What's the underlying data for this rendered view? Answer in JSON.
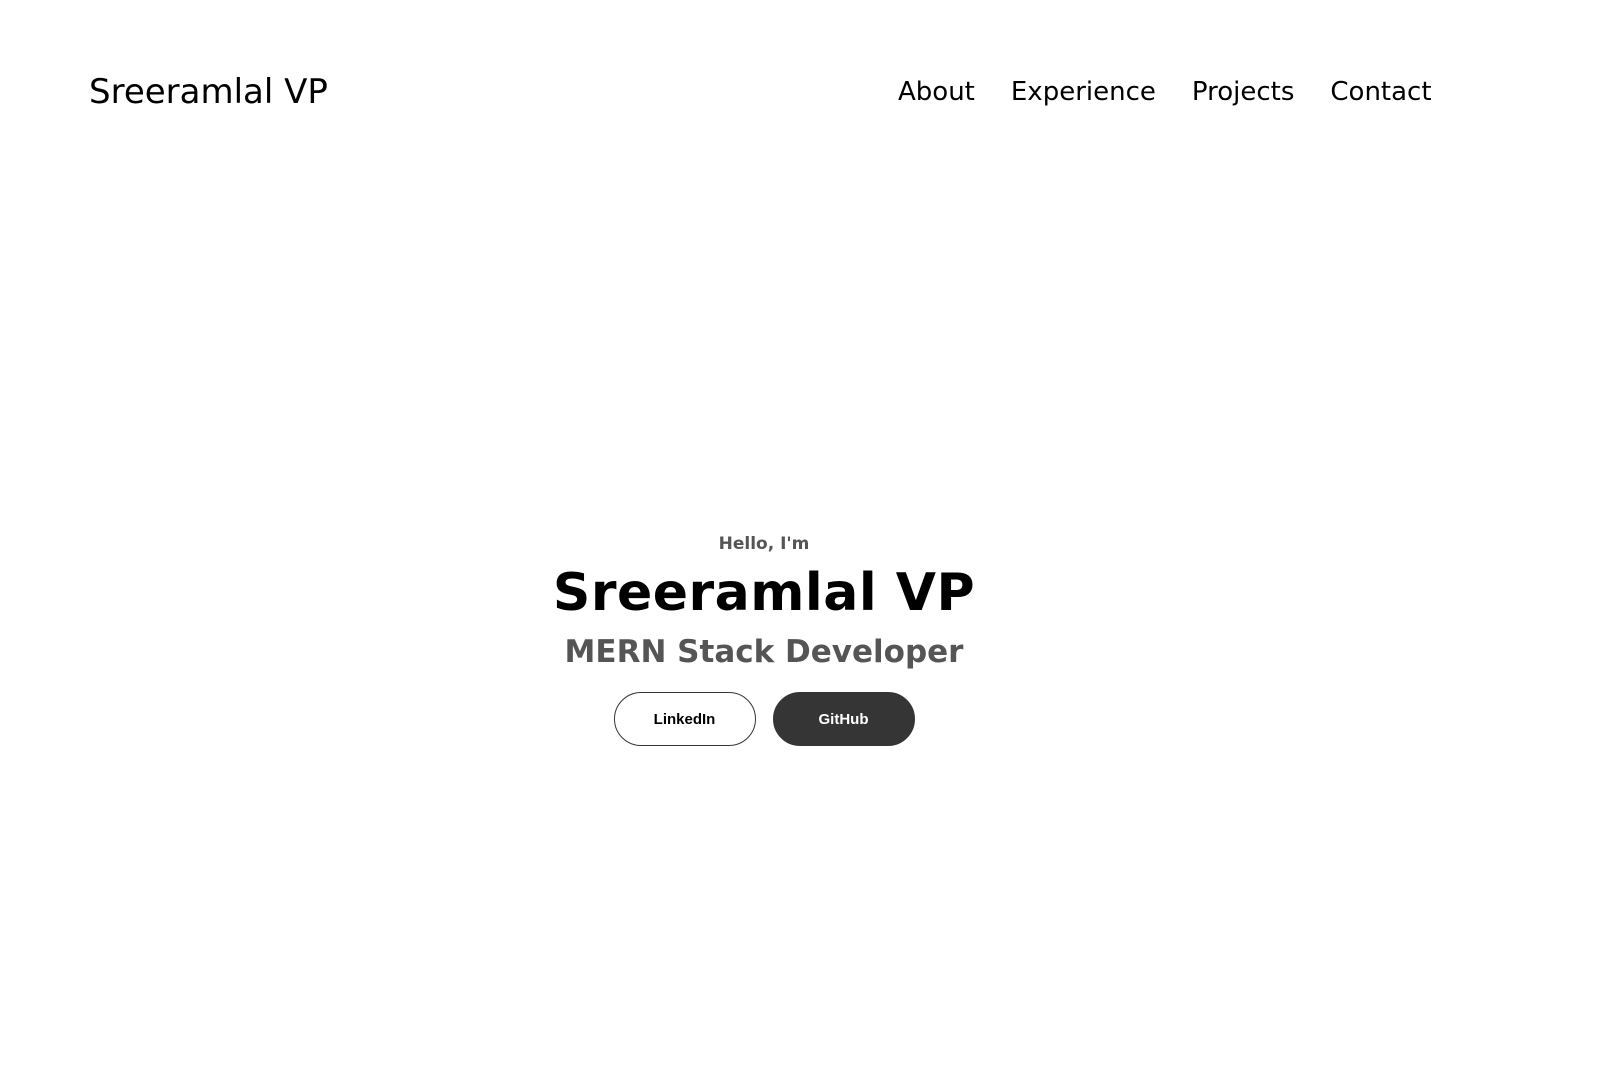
{
  "nav": {
    "logo": "Sreeramlal VP",
    "links": [
      {
        "label": "About"
      },
      {
        "label": "Experience"
      },
      {
        "label": "Projects"
      },
      {
        "label": "Contact"
      }
    ]
  },
  "hero": {
    "greeting": "Hello, I'm",
    "name": "Sreeramlal VP",
    "title": "MERN Stack Developer",
    "buttons": {
      "linkedin": "LinkedIn",
      "github": "GitHub"
    }
  },
  "colors": {
    "background": "#ffffff",
    "text": "#000000",
    "muted": "#555555",
    "button_dark": "#353535"
  }
}
